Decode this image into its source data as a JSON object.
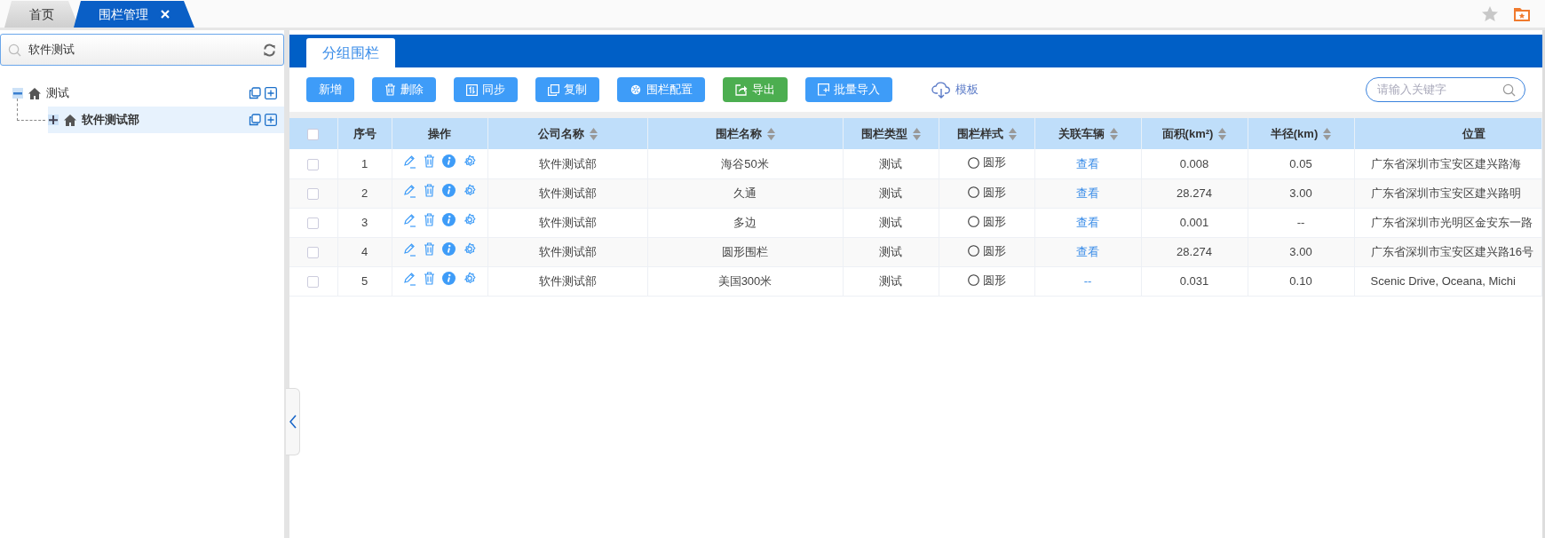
{
  "tabs": [
    {
      "label": "首页",
      "selected": false,
      "closable": false
    },
    {
      "label": "围栏管理",
      "selected": true,
      "closable": true
    }
  ],
  "sidebar": {
    "search": {
      "value": "软件测试"
    },
    "tree": [
      {
        "label": "测试",
        "expanded": true,
        "selected": false,
        "children": [
          {
            "label": "软件测试部",
            "expanded": false,
            "selected": true
          }
        ]
      }
    ]
  },
  "panel_tabs": [
    {
      "label": "分组围栏",
      "selected": true
    }
  ],
  "toolbar": {
    "buttons": [
      {
        "label": "新增",
        "kind": "primary"
      },
      {
        "label": "删除",
        "kind": "primary"
      },
      {
        "label": "同步",
        "kind": "primary"
      },
      {
        "label": "复制",
        "kind": "primary"
      },
      {
        "label": "围栏配置",
        "kind": "primary"
      },
      {
        "label": "导出",
        "kind": "success"
      },
      {
        "label": "批量导入",
        "kind": "primary"
      },
      {
        "label": "模板",
        "kind": "link"
      }
    ],
    "search": {
      "placeholder": "请输入关键字"
    }
  },
  "table": {
    "select_all_checked": false,
    "columns": [
      {
        "label": "序号",
        "sortable": false
      },
      {
        "label": "操作",
        "sortable": false
      },
      {
        "label": "公司名称",
        "sortable": true
      },
      {
        "label": "围栏名称",
        "sortable": true
      },
      {
        "label": "围栏类型",
        "sortable": true
      },
      {
        "label": "围栏样式",
        "sortable": true
      },
      {
        "label": "关联车辆",
        "sortable": true
      },
      {
        "label": "面积(km²)",
        "sortable": true
      },
      {
        "label": "半径(km)",
        "sortable": true
      },
      {
        "label": "位置",
        "sortable": false
      }
    ],
    "rows": [
      {
        "checked": false,
        "no": "1",
        "company": "软件测试部",
        "fence": "海谷50米",
        "type": "测试",
        "style": "圆形",
        "vehicles": "查看",
        "area": "0.008",
        "radius": "0.05",
        "location": "广东省深圳市宝安区建兴路海"
      },
      {
        "checked": false,
        "no": "2",
        "company": "软件测试部",
        "fence": "久通",
        "type": "测试",
        "style": "圆形",
        "vehicles": "查看",
        "area": "28.274",
        "radius": "3.00",
        "location": "广东省深圳市宝安区建兴路明"
      },
      {
        "checked": false,
        "no": "3",
        "company": "软件测试部",
        "fence": "多边",
        "type": "测试",
        "style": "圆形",
        "vehicles": "查看",
        "area": "0.001",
        "radius": "--",
        "location": "广东省深圳市光明区金安东一路"
      },
      {
        "checked": false,
        "no": "4",
        "company": "软件测试部",
        "fence": "圆形围栏",
        "type": "测试",
        "style": "圆形",
        "vehicles": "查看",
        "area": "28.274",
        "radius": "3.00",
        "location": "广东省深圳市宝安区建兴路16号"
      },
      {
        "checked": false,
        "no": "5",
        "company": "软件测试部",
        "fence": "美国300米",
        "type": "测试",
        "style": "圆形",
        "vehicles": "--",
        "area": "0.031",
        "radius": "0.10",
        "location": "Scenic Drive, Oceana, Michi"
      }
    ]
  }
}
